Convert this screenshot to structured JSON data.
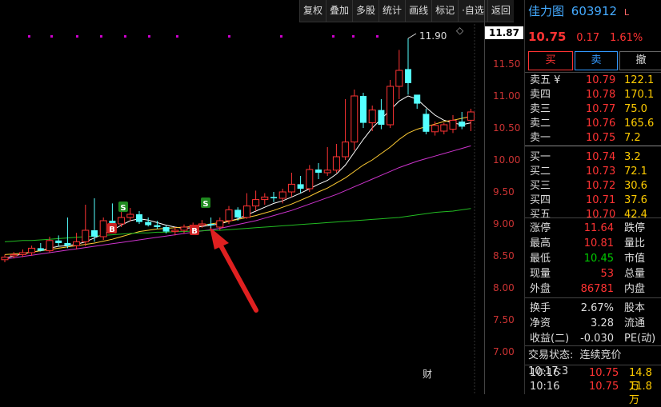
{
  "toolbar": {
    "buttons": [
      "复权",
      "叠加",
      "多股",
      "统计",
      "画线",
      "标记",
      "·自选",
      "返回"
    ]
  },
  "chart": {
    "y_ticks": [
      "11.50",
      "11.00",
      "10.50",
      "10.00",
      "9.50",
      "9.00",
      "8.50",
      "8.00",
      "7.50",
      "7.00"
    ],
    "current_price_tag": "11.87",
    "high_annotation": "11.90",
    "bottom_marker": "财",
    "signal_s": "S",
    "signal_b": "B",
    "diamond": "◇"
  },
  "chart_data": {
    "type": "candlestick",
    "ylim": [
      6.8,
      12.0
    ],
    "candles": [
      {
        "o": 8.44,
        "h": 8.52,
        "l": 8.4,
        "c": 8.48
      },
      {
        "o": 8.5,
        "h": 8.56,
        "l": 8.46,
        "c": 8.52
      },
      {
        "o": 8.52,
        "h": 8.6,
        "l": 8.48,
        "c": 8.55
      },
      {
        "o": 8.55,
        "h": 8.66,
        "l": 8.5,
        "c": 8.62
      },
      {
        "o": 8.62,
        "h": 8.7,
        "l": 8.57,
        "c": 8.58
      },
      {
        "o": 8.58,
        "h": 8.8,
        "l": 8.55,
        "c": 8.74
      },
      {
        "o": 8.74,
        "h": 8.82,
        "l": 8.65,
        "c": 8.7
      },
      {
        "o": 8.7,
        "h": 9.1,
        "l": 8.62,
        "c": 8.66
      },
      {
        "o": 8.66,
        "h": 8.86,
        "l": 8.6,
        "c": 8.72
      },
      {
        "o": 8.72,
        "h": 9.3,
        "l": 8.65,
        "c": 8.9
      },
      {
        "o": 8.9,
        "h": 9.4,
        "l": 8.72,
        "c": 8.8
      },
      {
        "o": 8.8,
        "h": 9.1,
        "l": 8.75,
        "c": 9.05
      },
      {
        "o": 9.05,
        "h": 9.32,
        "l": 8.9,
        "c": 9.0
      },
      {
        "o": 9.0,
        "h": 9.2,
        "l": 8.95,
        "c": 9.1
      },
      {
        "o": 9.1,
        "h": 9.25,
        "l": 9.04,
        "c": 9.15
      },
      {
        "o": 9.15,
        "h": 9.2,
        "l": 9.0,
        "c": 9.03
      },
      {
        "o": 9.03,
        "h": 9.1,
        "l": 8.96,
        "c": 8.98
      },
      {
        "o": 8.98,
        "h": 9.05,
        "l": 8.92,
        "c": 8.95
      },
      {
        "o": 8.95,
        "h": 8.98,
        "l": 8.85,
        "c": 8.88
      },
      {
        "o": 8.88,
        "h": 8.95,
        "l": 8.82,
        "c": 8.9
      },
      {
        "o": 8.9,
        "h": 8.99,
        "l": 8.85,
        "c": 8.95
      },
      {
        "o": 8.95,
        "h": 9.02,
        "l": 8.88,
        "c": 8.98
      },
      {
        "o": 8.98,
        "h": 9.06,
        "l": 8.94,
        "c": 9.0
      },
      {
        "o": 9.0,
        "h": 9.1,
        "l": 8.9,
        "c": 8.98
      },
      {
        "o": 8.95,
        "h": 9.1,
        "l": 8.9,
        "c": 9.05
      },
      {
        "o": 9.05,
        "h": 9.28,
        "l": 9.0,
        "c": 9.22
      },
      {
        "o": 9.22,
        "h": 9.26,
        "l": 9.05,
        "c": 9.1
      },
      {
        "o": 9.1,
        "h": 9.48,
        "l": 9.08,
        "c": 9.28
      },
      {
        "o": 9.28,
        "h": 9.52,
        "l": 9.2,
        "c": 9.38
      },
      {
        "o": 9.38,
        "h": 9.48,
        "l": 9.3,
        "c": 9.42
      },
      {
        "o": 9.42,
        "h": 9.5,
        "l": 9.34,
        "c": 9.4
      },
      {
        "o": 9.4,
        "h": 9.55,
        "l": 9.32,
        "c": 9.5
      },
      {
        "o": 9.5,
        "h": 9.8,
        "l": 9.42,
        "c": 9.62
      },
      {
        "o": 9.62,
        "h": 9.75,
        "l": 9.48,
        "c": 9.55
      },
      {
        "o": 9.55,
        "h": 9.92,
        "l": 9.5,
        "c": 9.85
      },
      {
        "o": 9.85,
        "h": 9.95,
        "l": 9.7,
        "c": 9.8
      },
      {
        "o": 9.8,
        "h": 10.2,
        "l": 9.75,
        "c": 9.84
      },
      {
        "o": 9.84,
        "h": 10.25,
        "l": 9.8,
        "c": 10.05
      },
      {
        "o": 10.05,
        "h": 10.95,
        "l": 10.0,
        "c": 10.28
      },
      {
        "o": 10.28,
        "h": 11.1,
        "l": 10.15,
        "c": 11.0
      },
      {
        "o": 11.0,
        "h": 11.05,
        "l": 10.5,
        "c": 10.58
      },
      {
        "o": 10.58,
        "h": 10.85,
        "l": 10.45,
        "c": 10.78
      },
      {
        "o": 10.78,
        "h": 10.95,
        "l": 10.48,
        "c": 10.55
      },
      {
        "o": 10.55,
        "h": 11.25,
        "l": 10.5,
        "c": 11.15
      },
      {
        "o": 11.15,
        "h": 11.72,
        "l": 10.95,
        "c": 11.4
      },
      {
        "o": 11.42,
        "h": 11.9,
        "l": 11.02,
        "c": 11.2
      },
      {
        "o": 11.02,
        "h": 10.95,
        "l": 10.8,
        "c": 10.88
      },
      {
        "o": 10.72,
        "h": 10.8,
        "l": 10.4,
        "c": 10.44
      },
      {
        "o": 10.44,
        "h": 10.6,
        "l": 10.38,
        "c": 10.54
      },
      {
        "o": 10.45,
        "h": 10.58,
        "l": 10.4,
        "c": 10.55
      },
      {
        "o": 10.48,
        "h": 10.7,
        "l": 10.42,
        "c": 10.62
      },
      {
        "o": 10.6,
        "h": 10.75,
        "l": 10.48,
        "c": 10.52
      },
      {
        "o": 10.62,
        "h": 10.8,
        "l": 10.45,
        "c": 10.75
      }
    ],
    "ma_lines": [
      {
        "color": "#ffffff",
        "values": [
          8.46,
          8.5,
          8.53,
          8.56,
          8.58,
          8.62,
          8.65,
          8.66,
          8.68,
          8.72,
          8.78,
          8.84,
          8.9,
          8.98,
          9.05,
          9.08,
          9.06,
          9.02,
          8.98,
          8.95,
          8.93,
          8.94,
          8.96,
          8.98,
          9.0,
          9.04,
          9.08,
          9.14,
          9.2,
          9.26,
          9.32,
          9.36,
          9.42,
          9.48,
          9.55,
          9.62,
          9.68,
          9.78,
          9.92,
          10.12,
          10.32,
          10.5,
          10.64,
          10.78,
          10.92,
          11.0,
          10.95,
          10.82,
          10.7,
          10.62,
          10.58,
          10.55,
          10.58
        ]
      },
      {
        "color": "#ffcc33",
        "values": [
          8.52,
          8.53,
          8.54,
          8.56,
          8.58,
          8.6,
          8.62,
          8.64,
          8.66,
          8.68,
          8.7,
          8.73,
          8.76,
          8.8,
          8.84,
          8.88,
          8.9,
          8.92,
          8.93,
          8.94,
          8.95,
          8.96,
          8.98,
          9.0,
          9.02,
          9.04,
          9.07,
          9.1,
          9.13,
          9.17,
          9.21,
          9.26,
          9.31,
          9.37,
          9.43,
          9.5,
          9.56,
          9.64,
          9.72,
          9.82,
          9.92,
          10.0,
          10.1,
          10.2,
          10.32,
          10.42,
          10.48,
          10.52,
          10.56,
          10.6,
          10.62,
          10.65,
          10.68
        ]
      },
      {
        "color": "#cc33cc",
        "values": [
          8.45,
          8.47,
          8.49,
          8.51,
          8.53,
          8.55,
          8.57,
          8.59,
          8.61,
          8.63,
          8.65,
          8.67,
          8.69,
          8.71,
          8.73,
          8.75,
          8.77,
          8.79,
          8.81,
          8.83,
          8.85,
          8.87,
          8.89,
          8.91,
          8.93,
          8.96,
          8.99,
          9.02,
          9.05,
          9.09,
          9.13,
          9.17,
          9.21,
          9.26,
          9.31,
          9.36,
          9.41,
          9.46,
          9.52,
          9.58,
          9.64,
          9.7,
          9.76,
          9.82,
          9.88,
          9.93,
          9.98,
          10.02,
          10.06,
          10.1,
          10.14,
          10.18,
          10.22
        ]
      },
      {
        "color": "#22bb22",
        "values": [
          8.72,
          8.73,
          8.74,
          8.74,
          8.75,
          8.76,
          8.77,
          8.78,
          8.79,
          8.8,
          8.81,
          8.82,
          8.83,
          8.84,
          8.85,
          8.86,
          8.86,
          8.87,
          8.87,
          8.88,
          8.88,
          8.89,
          8.89,
          8.9,
          8.9,
          8.91,
          8.92,
          8.93,
          8.94,
          8.95,
          8.96,
          8.97,
          8.98,
          8.99,
          9.0,
          9.01,
          9.02,
          9.03,
          9.04,
          9.05,
          9.06,
          9.07,
          9.08,
          9.09,
          9.1,
          9.12,
          9.14,
          9.16,
          9.18,
          9.19,
          9.2,
          9.22,
          9.24
        ]
      }
    ]
  },
  "quote": {
    "stock_name": "佳力图",
    "stock_code": "603912",
    "flag": "L",
    "price": "10.75",
    "change": "0.17",
    "change_pct": "1.61%",
    "buy_btn": "买",
    "sell_btn": "卖",
    "cancel_btn": "撤",
    "asks": [
      {
        "label": "卖五 ¥",
        "price": "10.79",
        "vol": "122.1"
      },
      {
        "label": "卖四",
        "price": "10.78",
        "vol": "170.1"
      },
      {
        "label": "卖三",
        "price": "10.77",
        "vol": "75.0"
      },
      {
        "label": "卖二",
        "price": "10.76",
        "vol": "165.6"
      },
      {
        "label": "卖一",
        "price": "10.75",
        "vol": "7.2"
      }
    ],
    "bids": [
      {
        "label": "买一",
        "price": "10.74",
        "vol": "3.2"
      },
      {
        "label": "买二",
        "price": "10.73",
        "vol": "72.1"
      },
      {
        "label": "买三",
        "price": "10.72",
        "vol": "30.6"
      },
      {
        "label": "买四",
        "price": "10.71",
        "vol": "37.6"
      },
      {
        "label": "买五",
        "price": "10.70",
        "vol": "42.4"
      }
    ],
    "stats": [
      {
        "k": "涨停",
        "v": "11.64",
        "k2": "跌停"
      },
      {
        "k": "最高",
        "v": "10.81",
        "k2": "量比"
      },
      {
        "k": "最低",
        "v": "10.45",
        "k2": "市值"
      },
      {
        "k": "现量",
        "v": "53",
        "k2": "总量"
      },
      {
        "k": "外盘",
        "v": "86781",
        "k2": "内盘"
      }
    ],
    "stats2": [
      {
        "k": "换手",
        "v": "2.67%",
        "k2": "股本"
      },
      {
        "k": "净资",
        "v": "3.28",
        "k2": "流通"
      },
      {
        "k": "收益(二)",
        "v": "-0.030",
        "k2": "PE(动)"
      }
    ],
    "trade_status_label": "交易状态:",
    "trade_status_value": "连续竞价",
    "trade_status_time": "10:17:3",
    "ticks": [
      {
        "t": "10:16",
        "p": "10.75",
        "v": "14.8万"
      },
      {
        "t": "10:16",
        "p": "10.75",
        "v": "11.8万"
      }
    ]
  }
}
